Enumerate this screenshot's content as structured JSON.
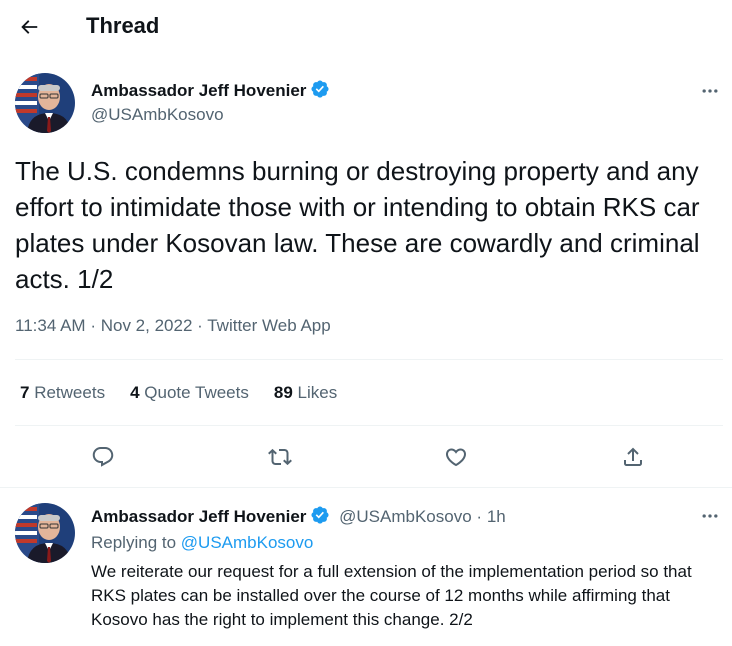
{
  "header": {
    "title": "Thread"
  },
  "main_tweet": {
    "author_name": "Ambassador Jeff Hovenier",
    "handle": "@USAmbKosovo",
    "text": "The U.S. condemns burning or destroying property and any effort to intimidate those with or intending to obtain RKS car plates under Kosovan law. These are cowardly and criminal acts. 1/2",
    "time": "11:34 AM",
    "date": "Nov 2, 2022",
    "source": "Twitter Web App",
    "separator": "·",
    "stats": {
      "retweets_count": "7",
      "retweets_label": "Retweets",
      "quotes_count": "4",
      "quotes_label": "Quote Tweets",
      "likes_count": "89",
      "likes_label": "Likes"
    }
  },
  "reply_tweet": {
    "author_name": "Ambassador Jeff Hovenier",
    "handle": "@USAmbKosovo",
    "separator": "·",
    "age": "1h",
    "replying_prefix": "Replying to",
    "replying_to": "@USAmbKosovo",
    "text": "We reiterate our request for a full extension of the implementation period so that RKS plates can be installed over the course of 12 months while affirming that Kosovo has the right to implement this change. 2/2"
  },
  "icons": {
    "back": "arrow-left-icon",
    "more": "more-horizontal-icon",
    "verified": "verified-badge-icon",
    "reply": "reply-icon",
    "retweet": "retweet-icon",
    "like": "heart-icon",
    "share": "share-icon"
  },
  "colors": {
    "accent": "#1d9bf0",
    "text_primary": "#0f1419",
    "text_secondary": "#536471",
    "divider": "#eff3f4"
  }
}
